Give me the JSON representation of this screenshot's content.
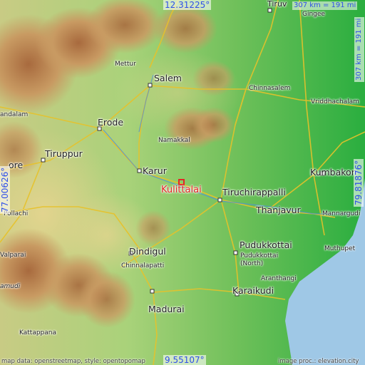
{
  "coordinates": {
    "top": "12.31225°",
    "bottom": "9.55107°",
    "left": "77.00626°",
    "right": "79.81876°"
  },
  "scale": {
    "top": "307 km = 191 mi",
    "right": "307 km = 191 mi"
  },
  "attribution": {
    "left": "map data: openstreetmap, style: opentopomap",
    "right": "image proc.: elevation.city"
  },
  "selected_place": "Kulittalai",
  "places": {
    "tiruv": "Tiruv",
    "gingee": "Gingee",
    "mettur": "Mettur",
    "salem": "Salem",
    "chinnasalem": "Chinnasalem",
    "vriddhachalam": "Vriddhachalam",
    "andalam": "andalam",
    "erode": "Erode",
    "namakkal": "Namakkal",
    "tiruppur": "Tiruppur",
    "ore": "ore",
    "karur": "Karur",
    "tiruchirappalli": "Tiruchirappalli",
    "kumbakon": "Kumbakon",
    "thanjavur": "Thanjavur",
    "mannargudi": "Mannargudi",
    "pollachi": "Pollachi",
    "valparai": "Valparai",
    "dindigul": "Dindigul",
    "pudukkottai": "Pudukkottai",
    "pudukkottai_north": "Pudukkottai\n(North)",
    "chinnalapatti": "Chinnalapatti",
    "muthupet": "Muthupet",
    "aranthangi": "Aranthangi",
    "mamudi": "amudi",
    "karaikudi": "Karaikudi",
    "madurai": "Madurai",
    "kattappana": "Kattappana"
  },
  "colors": {
    "lowland": "#2eae40",
    "plain": "#8fcf62",
    "upland": "#d8cf8a",
    "hills": "#b87a48",
    "sea": "#9fc8e6",
    "selected_marker": "#e32626",
    "coord_text": "#3050e8"
  }
}
